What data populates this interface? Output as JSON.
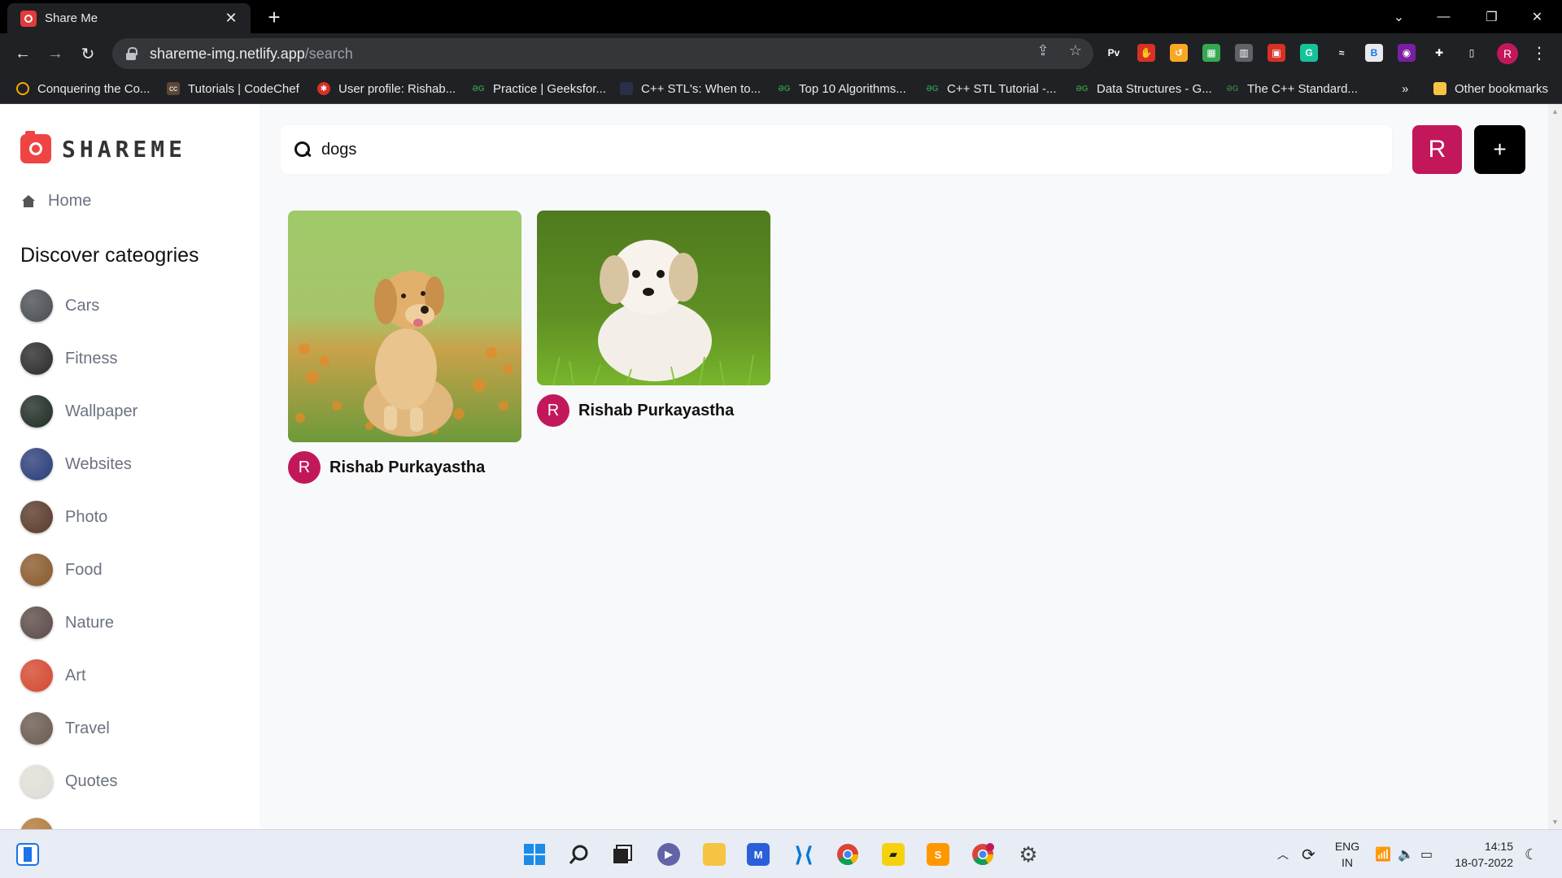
{
  "browser": {
    "tab_title": "Share Me",
    "tab_close": "✕",
    "new_tab": "+",
    "window_controls": {
      "dropdown": "⌄",
      "minimize": "—",
      "restore": "❐",
      "close": "✕"
    },
    "url_host": "shareme-img.netlify.app",
    "url_path": "/search",
    "nav": {
      "back": "←",
      "forward": "→",
      "reload": "↻"
    },
    "profile_initial": "R",
    "extensions": [
      {
        "name": "pv",
        "label": "Pv",
        "color": "#202124"
      },
      {
        "name": "stop",
        "label": "✋",
        "color": "#d93025"
      },
      {
        "name": "switch",
        "label": "↺",
        "color": "#f9a825"
      },
      {
        "name": "calc",
        "label": "▦",
        "color": "#34a853"
      },
      {
        "name": "stats",
        "label": "▥",
        "color": "#5f6368"
      },
      {
        "name": "chart",
        "label": "▣",
        "color": "#d93025"
      },
      {
        "name": "grammarly",
        "label": "G",
        "color": "#15c39a"
      },
      {
        "name": "ext-t",
        "label": "≈",
        "color": "#202124"
      },
      {
        "name": "ext-b",
        "label": "B",
        "color": "#e8eaed"
      },
      {
        "name": "color",
        "label": "◉",
        "color": "#7b1fa2"
      },
      {
        "name": "puzzle",
        "label": "✚",
        "color": "#202124"
      },
      {
        "name": "sidepanel",
        "label": "▯",
        "color": "#202124"
      }
    ],
    "bookmarks": [
      "Conquering the Co...",
      "Tutorials | CodeChef",
      "User profile: Rishab...",
      "Practice | Geeksfor...",
      "C++ STL's: When to...",
      "Top 10 Algorithms...",
      "C++ STL Tutorial -...",
      "Data Structures - G...",
      "The C++ Standard..."
    ],
    "bookmarks_overflow": "»",
    "other_bookmarks": "Other bookmarks"
  },
  "sidebar": {
    "logo_text": "SHAREME",
    "home_label": "Home",
    "discover_title": "Discover cateogries",
    "categories": [
      {
        "label": "Cars",
        "color": "#4a4e54"
      },
      {
        "label": "Fitness",
        "color": "#2b2b2b"
      },
      {
        "label": "Wallpaper",
        "color": "#1f2d24"
      },
      {
        "label": "Websites",
        "color": "#2b3e7a"
      },
      {
        "label": "Photo",
        "color": "#5a3a2a"
      },
      {
        "label": "Food",
        "color": "#8a5a2c"
      },
      {
        "label": "Nature",
        "color": "#5b4b48"
      },
      {
        "label": "Art",
        "color": "#d4482f"
      },
      {
        "label": "Travel",
        "color": "#6b5a50"
      },
      {
        "label": "Quotes",
        "color": "#e0ddd6"
      },
      {
        "label": "",
        "color": "#b07a3a"
      }
    ]
  },
  "search": {
    "value": "dogs",
    "placeholder": "Search"
  },
  "header": {
    "user_initial": "R",
    "add_label": "+"
  },
  "pins": [
    {
      "author": "Rishab Purkayastha",
      "author_initial": "R",
      "image": "golden-retriever-puppy"
    },
    {
      "author": "Rishab Purkayastha",
      "author_initial": "R",
      "image": "white-fluffy-puppy"
    }
  ],
  "taskbar": {
    "apps": [
      "widgets-icon",
      "start-icon",
      "search-icon",
      "task-view-icon",
      "teams-icon",
      "file-explorer-icon",
      "whiteboard-icon",
      "vscode-icon",
      "chrome-icon",
      "sticky-notes-icon",
      "sublime-icon",
      "chrome-profile-icon",
      "settings-icon"
    ],
    "language_line1": "ENG",
    "language_line2": "IN",
    "time": "14:15",
    "date": "18-07-2022"
  }
}
